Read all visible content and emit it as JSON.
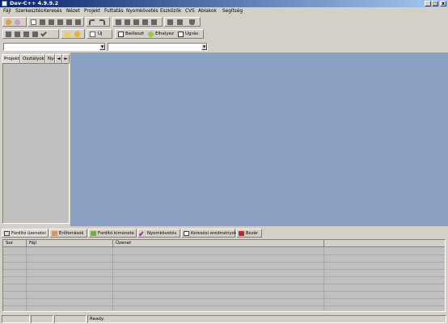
{
  "window": {
    "title": "Dev-C++ 4.9.9.2",
    "minimize": "_",
    "maximize": "□",
    "close": "x"
  },
  "menu": [
    "Fájl",
    "Szerkesztés",
    "Keresés",
    "Nézet",
    "Projekt",
    "Futtatás",
    "Nyomkövetés",
    "Eszközök",
    "CVS",
    "Ablakok",
    "Segítség"
  ],
  "toolbar": {
    "new_label": "Új",
    "insert_label": "Beilleszt",
    "toggle_label": "Elhelyez",
    "goto_label": "Ugrás"
  },
  "left_panel": {
    "tabs": [
      "Projekt",
      "Osztályok",
      "Nyo"
    ]
  },
  "bottom_tabs": [
    "Fordító üzenetei",
    "Erőforrások",
    "Fordító kimenete",
    "Nyomkövetés",
    "Keresési eredmények",
    "Bezár"
  ],
  "messages_table": {
    "columns": [
      "Sor",
      "Fájl",
      "Üzenet",
      ""
    ],
    "rows": []
  },
  "statusbar": {
    "panels": [
      "",
      "",
      "",
      "",
      "Ready."
    ]
  }
}
